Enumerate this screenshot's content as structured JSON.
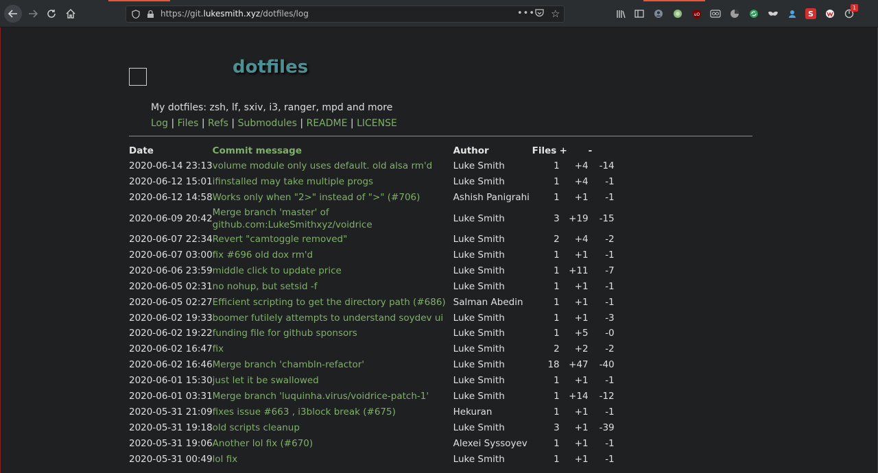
{
  "browser": {
    "url_prefix": "https://git.",
    "url_domain": "lukesmith.xyz",
    "url_path": "/dotfiles/log",
    "more_label": "•••",
    "notification_count": "1"
  },
  "repo": {
    "title": "dotfiles",
    "description": "My dotfiles: zsh, lf, sxiv, i3, ranger, mpd and more",
    "nav": [
      "Log",
      "Files",
      "Refs",
      "Submodules",
      "README",
      "LICENSE"
    ],
    "nav_separator": "|"
  },
  "table": {
    "headers": {
      "date": "Date",
      "message": "Commit message",
      "author": "Author",
      "files": "Files",
      "add": "+",
      "del": "-"
    },
    "rows": [
      {
        "date": "2020-06-14 23:13",
        "message": "volume module only uses default. old alsa rm'd",
        "author": "Luke Smith",
        "files": "1",
        "add": "+4",
        "del": "-14"
      },
      {
        "date": "2020-06-12 15:01",
        "message": "ifinstalled may take multiple progs",
        "author": "Luke Smith",
        "files": "1",
        "add": "+4",
        "del": "-1"
      },
      {
        "date": "2020-06-12 14:58",
        "message": "Works only when \"2>\" instead of \">\" (#706)",
        "author": "Ashish Panigrahi",
        "files": "1",
        "add": "+1",
        "del": "-1"
      },
      {
        "date": "2020-06-09 20:42",
        "message": "Merge branch 'master' of github.com:LukeSmithxyz/voidrice",
        "author": "Luke Smith",
        "files": "3",
        "add": "+19",
        "del": "-15"
      },
      {
        "date": "2020-06-07 22:34",
        "message": "Revert \"camtoggle removed\"",
        "author": "Luke Smith",
        "files": "2",
        "add": "+4",
        "del": "-2"
      },
      {
        "date": "2020-06-07 03:00",
        "message": "fix #696 old dox rm'd",
        "author": "Luke Smith",
        "files": "1",
        "add": "+1",
        "del": "-1"
      },
      {
        "date": "2020-06-06 23:59",
        "message": "middle click to update price",
        "author": "Luke Smith",
        "files": "1",
        "add": "+11",
        "del": "-7"
      },
      {
        "date": "2020-06-05 02:31",
        "message": "no nohup, but setsid -f",
        "author": "Luke Smith",
        "files": "1",
        "add": "+1",
        "del": "-1"
      },
      {
        "date": "2020-06-05 02:27",
        "message": "Efficient scripting to get the directory path (#686)",
        "author": "Salman Abedin",
        "files": "1",
        "add": "+1",
        "del": "-1"
      },
      {
        "date": "2020-06-02 19:33",
        "message": "boomer futilely attempts to understand soydev ui",
        "author": "Luke Smith",
        "files": "1",
        "add": "+1",
        "del": "-3"
      },
      {
        "date": "2020-06-02 19:22",
        "message": "funding file for github sponsors",
        "author": "Luke Smith",
        "files": "1",
        "add": "+5",
        "del": "-0"
      },
      {
        "date": "2020-06-02 16:47",
        "message": "fix",
        "author": "Luke Smith",
        "files": "2",
        "add": "+2",
        "del": "-2"
      },
      {
        "date": "2020-06-02 16:46",
        "message": "Merge branch 'chambln-refactor'",
        "author": "Luke Smith",
        "files": "18",
        "add": "+47",
        "del": "-40"
      },
      {
        "date": "2020-06-01 15:30",
        "message": "just let it be swallowed",
        "author": "Luke Smith",
        "files": "1",
        "add": "+1",
        "del": "-1"
      },
      {
        "date": "2020-06-01 03:31",
        "message": "Merge branch 'luquinha.virus/voidrice-patch-1'",
        "author": "Luke Smith",
        "files": "1",
        "add": "+14",
        "del": "-12"
      },
      {
        "date": "2020-05-31 21:09",
        "message": "fixes issue #663 , i3block break (#675)",
        "author": "Hekuran",
        "files": "1",
        "add": "+1",
        "del": "-1"
      },
      {
        "date": "2020-05-31 19:18",
        "message": "old scripts cleanup",
        "author": "Luke Smith",
        "files": "3",
        "add": "+1",
        "del": "-39"
      },
      {
        "date": "2020-05-31 19:06",
        "message": "Another lol fix (#670)",
        "author": "Alexei Syssoyev",
        "files": "1",
        "add": "+1",
        "del": "-1"
      },
      {
        "date": "2020-05-31 00:49",
        "message": "lol fix",
        "author": "Luke Smith",
        "files": "1",
        "add": "+1",
        "del": "-1"
      }
    ]
  },
  "icons": {
    "back": "arrow-left-icon",
    "forward": "arrow-right-icon",
    "reload": "reload-icon",
    "home": "home-icon",
    "shield": "shield-icon",
    "lock": "lock-icon",
    "pocket": "pocket-icon",
    "star": "star-icon"
  }
}
